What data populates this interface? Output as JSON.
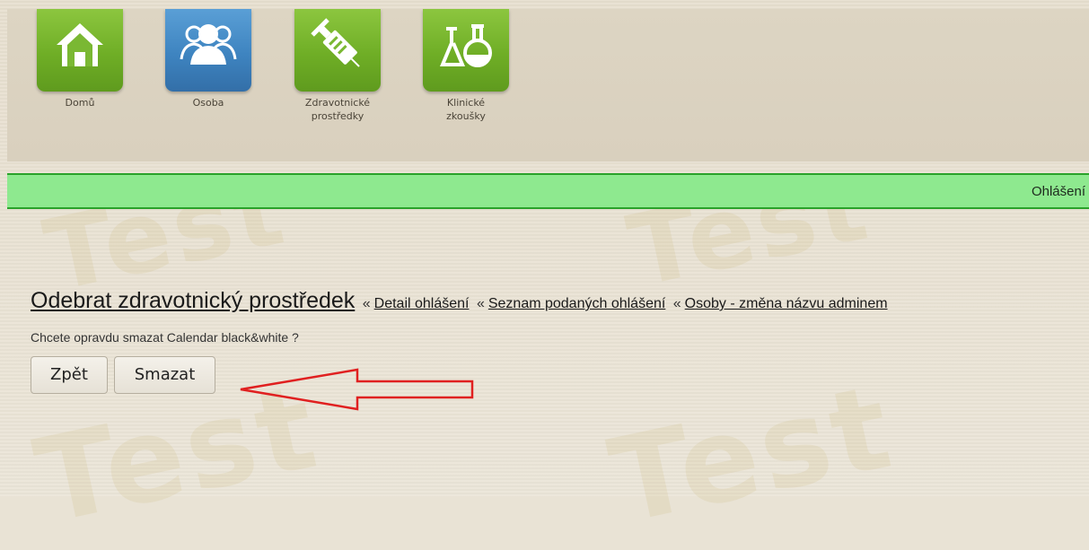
{
  "nav": {
    "tiles": [
      {
        "label": "Domů",
        "icon": "home-icon",
        "color": "#6fae26"
      },
      {
        "label": "Osoba",
        "icon": "people-icon",
        "color": "#3e84c0"
      },
      {
        "label_line1": "Zdravotnické",
        "label_line2": "prostředky",
        "icon": "syringe-icon",
        "color": "#6fae26"
      },
      {
        "label_line1": "Klinické",
        "label_line2": "zkoušky",
        "icon": "flask-icon",
        "color": "#6fae26"
      }
    ]
  },
  "ribbon": {
    "text": "Ohlášení",
    "background": "#8ee98f",
    "border": "#2aa22a"
  },
  "watermark": {
    "text": "Test"
  },
  "main": {
    "title": "Odebrat zdravotnický prostředek",
    "separator": "«",
    "breadcrumbs": [
      "Detail ohlášení",
      "Seznam podaných ohlášení",
      "Osoby - změna názvu adminem"
    ],
    "confirm_text": "Chcete opravdu smazat Calendar black&white ?",
    "back_button": "Zpět",
    "delete_button": "Smazat"
  },
  "annotation": {
    "shape": "arrow-left",
    "color": "#e02020"
  }
}
